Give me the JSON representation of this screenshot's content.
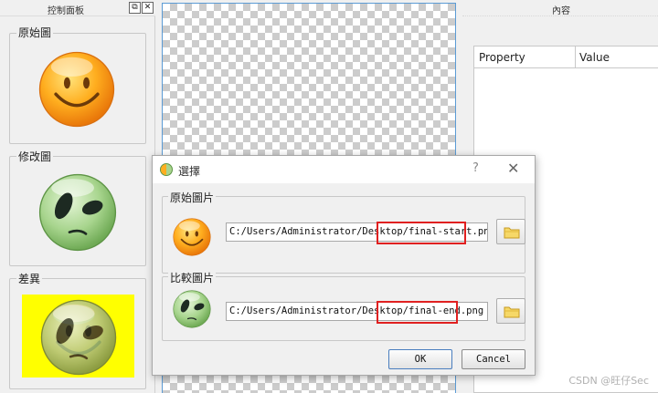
{
  "left_panel": {
    "title": "控制面板",
    "float_button": "⧉",
    "close_button": "✕",
    "groups": [
      {
        "label": "原始圖",
        "icon": "smiley-face-icon"
      },
      {
        "label": "修改圖",
        "icon": "alien-face-icon"
      },
      {
        "label": "差異",
        "icon": "diff-face-icon"
      }
    ]
  },
  "right_panel": {
    "title": "內容",
    "columns": [
      "Property",
      "Value"
    ]
  },
  "dialog": {
    "title": "選擇",
    "help": "?",
    "close": "✕",
    "original": {
      "label": "原始圖片",
      "path": "C:/Users/Administrator/Desktop/final-start.png",
      "icon": "smiley-face-icon"
    },
    "compare": {
      "label": "比較圖片",
      "path": "C:/Users/Administrator/Desktop/final-end.png",
      "icon": "alien-face-icon"
    },
    "ok_label": "OK",
    "cancel_label": "Cancel"
  },
  "watermark": "CSDN @旺仔Sec",
  "colors": {
    "canvas_border": "#5b9bd5",
    "highlight": "#e02020",
    "diff_background": "#ffff00"
  }
}
